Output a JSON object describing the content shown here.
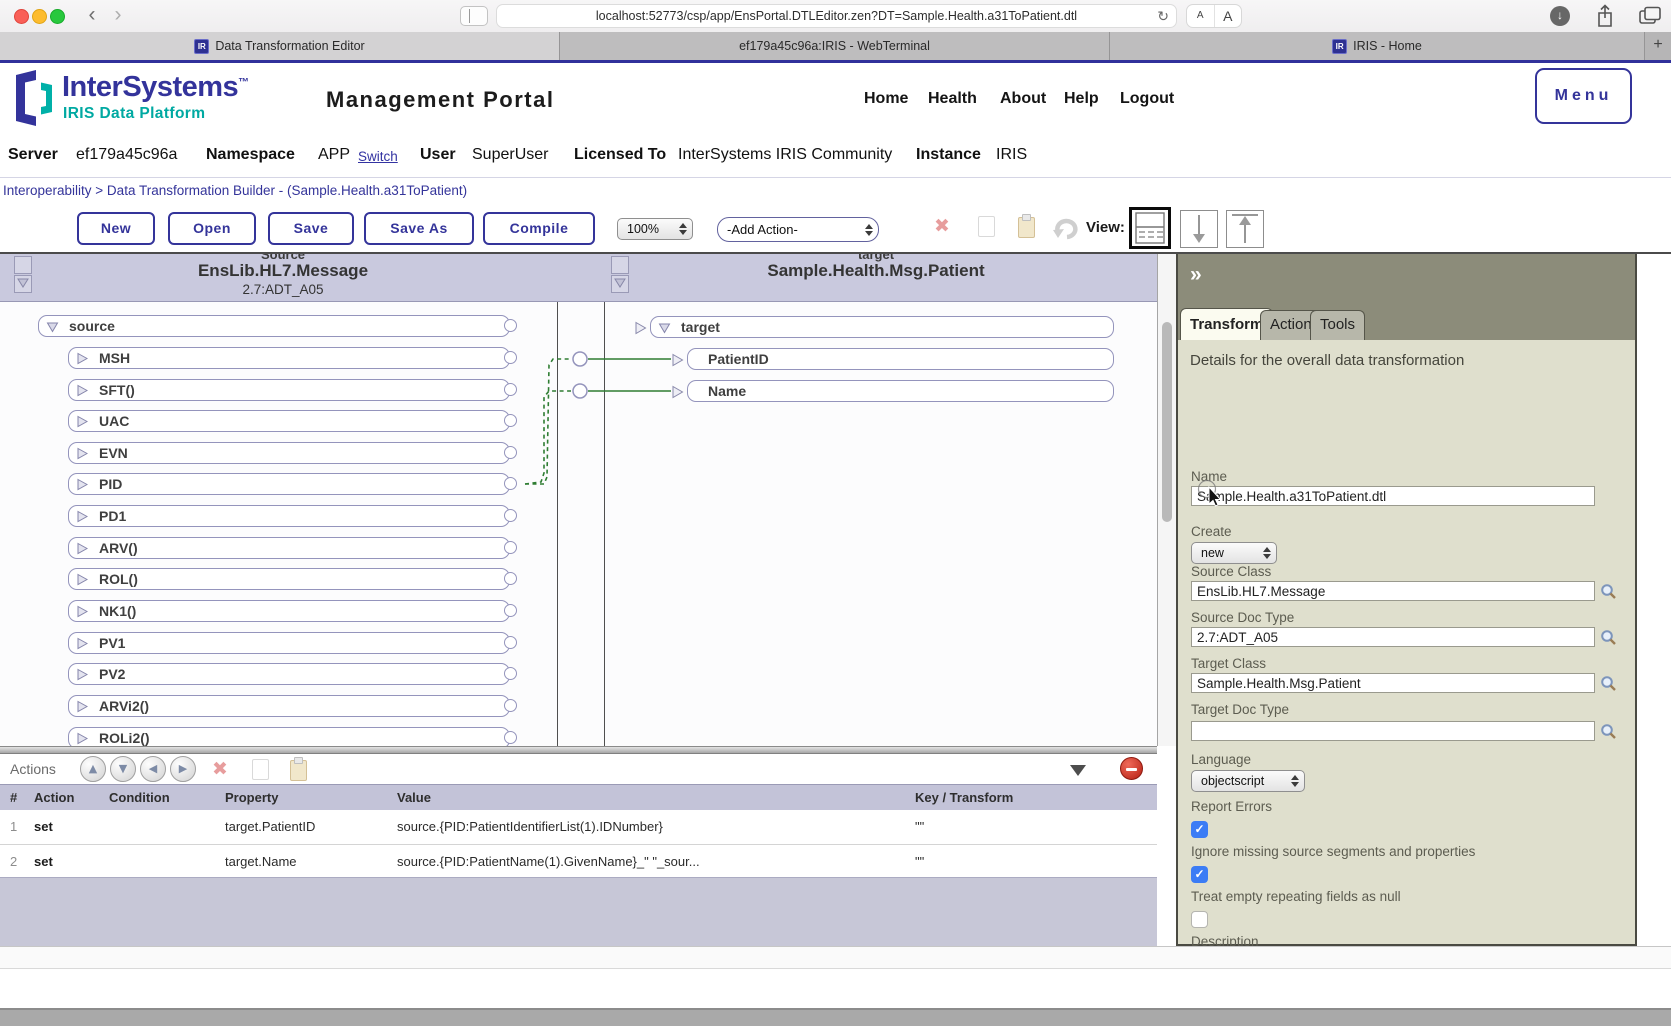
{
  "colors": {
    "accent": "#33339b",
    "teal": "#00a9a2",
    "connector_green": "#2e7d32",
    "band_lavender": "#c9c9de",
    "inspector_bg": "#dfdfcd",
    "checkbox_blue": "#3b7cf5"
  },
  "icons": {
    "back": "‹",
    "forward": "›",
    "reload": "↻",
    "download_arrow": "↓",
    "font_small": "A",
    "font_large": "A",
    "new_tab": "+",
    "favicon": "IR",
    "collapse": "»",
    "delete_x": "✖",
    "check": "✓",
    "arrow_up": "▲",
    "arrow_down": "▼",
    "arrow_left": "◀",
    "arrow_right": "▶"
  },
  "browser": {
    "url": "localhost:52773/csp/app/EnsPortal.DTLEditor.zen?DT=Sample.Health.a31ToPatient.dtl",
    "tabs": [
      {
        "label": "Data Transformation Editor"
      },
      {
        "label": "ef179a45c96a:IRIS - WebTerminal"
      },
      {
        "label": "IRIS - Home"
      }
    ]
  },
  "portal": {
    "logo": {
      "brand": "InterSystems",
      "tm": "™",
      "platform": "IRIS Data Platform"
    },
    "title": "Management Portal",
    "nav": [
      "Home",
      "Health",
      "About",
      "Help",
      "Logout"
    ],
    "menu": "Menu"
  },
  "server_bar": {
    "items": [
      {
        "label": "Server",
        "value": "ef179a45c96a"
      },
      {
        "label": "Namespace",
        "value": "APP"
      },
      {
        "label": "User",
        "value": "SuperUser"
      },
      {
        "label": "Licensed To",
        "value": "InterSystems IRIS Community"
      },
      {
        "label": "Instance",
        "value": "IRIS"
      }
    ],
    "switch_label": "Switch"
  },
  "ribbon": {
    "breadcrumb": "Interoperability > Data Transformation Builder  - (Sample.Health.a31ToPatient)"
  },
  "toolbar": {
    "buttons": [
      "New",
      "Open",
      "Save",
      "Save As",
      "Compile"
    ],
    "zoom": "100%",
    "add_action": "-Add Action-",
    "view_label": "View:"
  },
  "diagram": {
    "source_panel": {
      "kicker": "Source",
      "class": "EnsLib.HL7.Message",
      "doctype": "2.7:ADT_A05",
      "root": "source",
      "rows": [
        "MSH",
        "SFT()",
        "UAC",
        "EVN",
        "PID",
        "PD1",
        "ARV()",
        "ROL()",
        "NK1()",
        "PV1",
        "PV2",
        "ARVi2()",
        "ROLi2()"
      ]
    },
    "target_panel": {
      "kicker": "target",
      "class": "Sample.Health.Msg.Patient",
      "root": "target",
      "rows": [
        "PatientID",
        "Name"
      ]
    }
  },
  "inspector": {
    "collapse_icon": "»",
    "tabs": [
      "Transform",
      "Action",
      "Tools"
    ],
    "heading": "Details for the overall data transformation",
    "fields": {
      "name": {
        "label": "Name",
        "value": "Sample.Health.a31ToPatient.dtl"
      },
      "create": {
        "label": "Create",
        "value": "new"
      },
      "source_class": {
        "label": "Source Class",
        "value": "EnsLib.HL7.Message"
      },
      "source_doc_type": {
        "label": "Source Doc Type",
        "value": "2.7:ADT_A05"
      },
      "target_class": {
        "label": "Target Class",
        "value": "Sample.Health.Msg.Patient"
      },
      "target_doc_type": {
        "label": "Target Doc Type",
        "value": ""
      },
      "language": {
        "label": "Language",
        "value": "objectscript"
      },
      "report_errors": {
        "label": "Report Errors",
        "checked": true
      },
      "ignore_missing": {
        "label": "Ignore missing source segments and properties",
        "checked": true
      },
      "treat_empty": {
        "label": "Treat empty repeating fields as null",
        "checked": false
      },
      "description": {
        "label": "Description",
        "value": ""
      }
    }
  },
  "actions_panel": {
    "title": "Actions",
    "columns": [
      "#",
      "Action",
      "Condition",
      "Property",
      "Value",
      "Key / Transform"
    ],
    "rows": [
      {
        "num": "1",
        "action": "set",
        "condition": "",
        "property": "target.PatientID",
        "value": "source.{PID:PatientIdentifierList(1).IDNumber}",
        "key": "\"\""
      },
      {
        "num": "2",
        "action": "set",
        "condition": "",
        "property": "target.Name",
        "value": "source.{PID:PatientName(1).GivenName}_\" \"_sour...",
        "key": "\"\""
      }
    ]
  }
}
